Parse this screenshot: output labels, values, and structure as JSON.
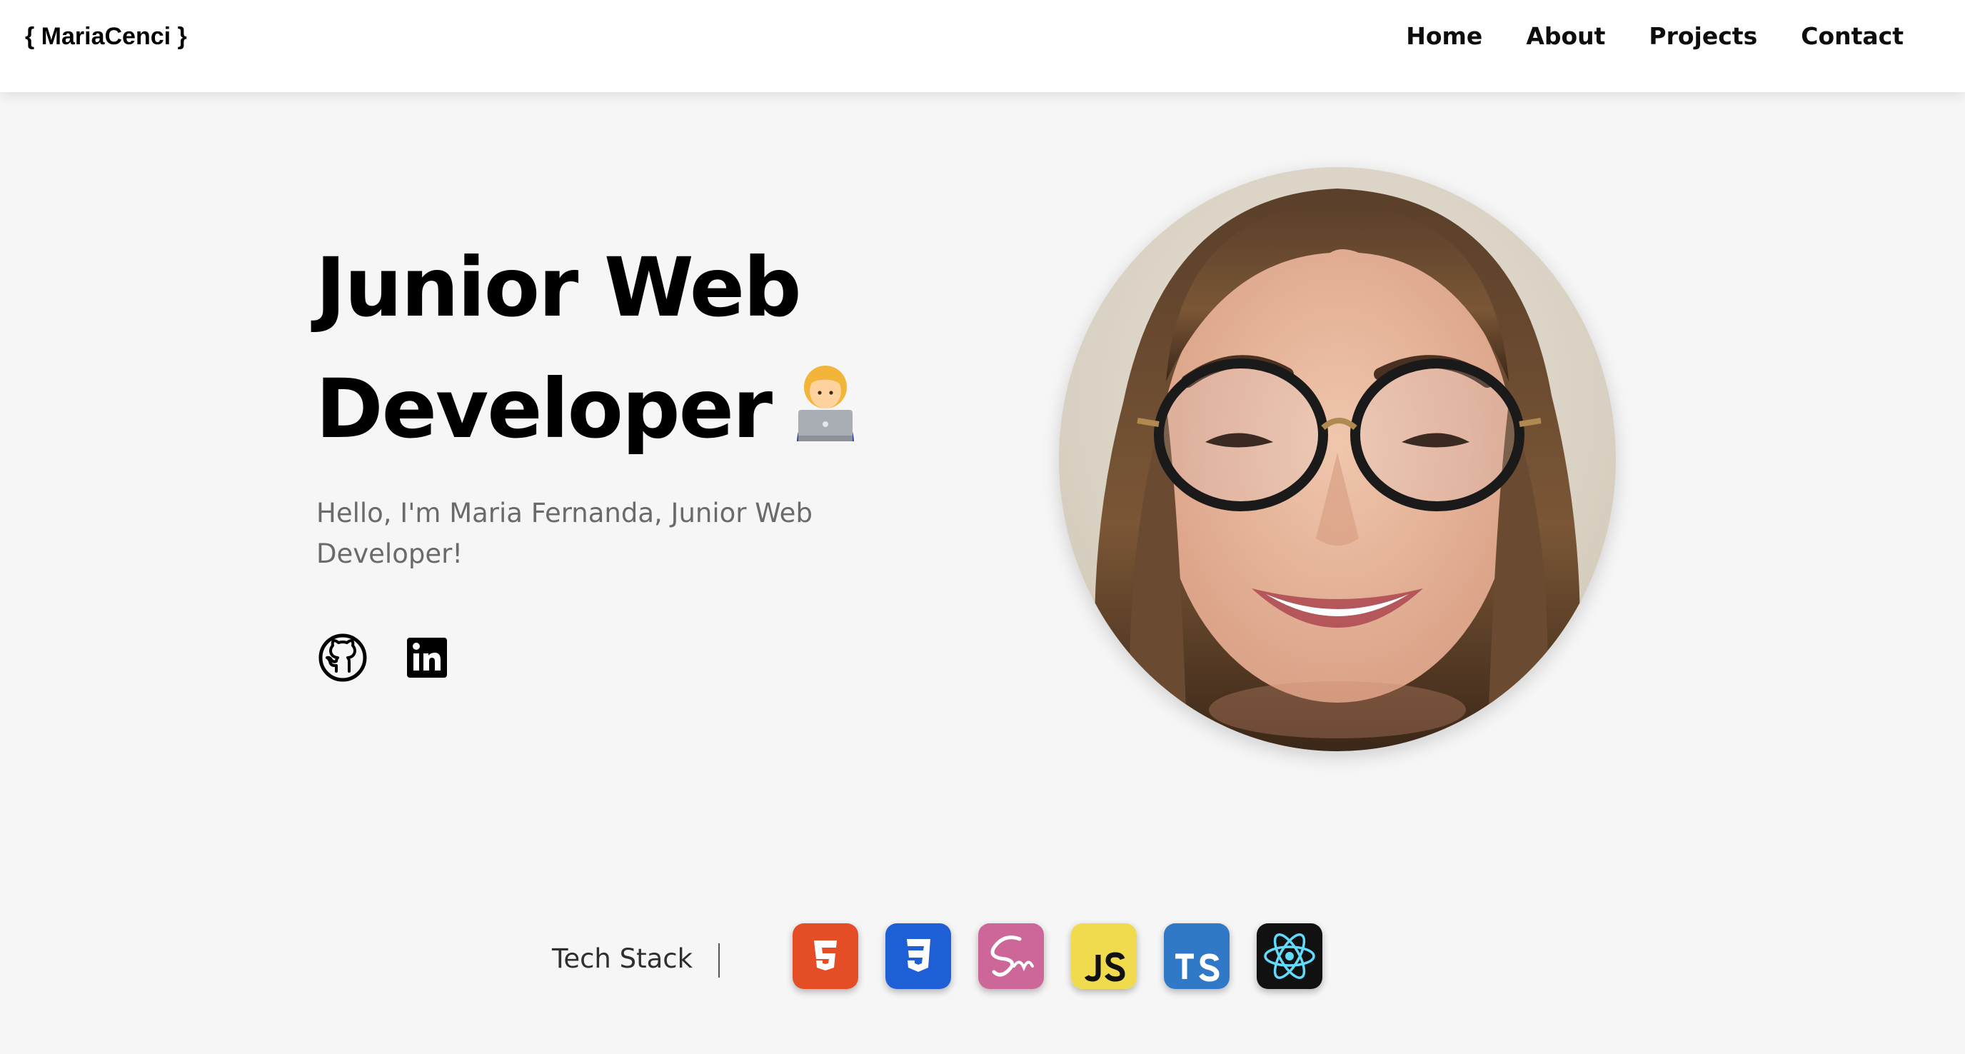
{
  "navbar": {
    "brand": "{ MariaCenci }",
    "links": [
      {
        "label": "Home"
      },
      {
        "label": "About"
      },
      {
        "label": "Projects"
      },
      {
        "label": "Contact"
      }
    ]
  },
  "hero": {
    "title_line1": "Junior Web",
    "title_line2": "Developer",
    "title_emoji": "woman-technologist-emoji-icon",
    "subtitle": "Hello, I'm Maria Fernanda, Junior Web Developer!",
    "socials": [
      {
        "icon": "github-icon"
      },
      {
        "icon": "linkedin-icon"
      }
    ],
    "portrait": "portrait-photo"
  },
  "tech_stack": {
    "label": "Tech Stack",
    "icons": [
      {
        "icon": "html5-icon",
        "color": "#e44d26"
      },
      {
        "icon": "css3-icon",
        "color": "#1f5fd6"
      },
      {
        "icon": "sass-icon",
        "color": "#cd6799"
      },
      {
        "icon": "javascript-icon",
        "color": "#f0db4f"
      },
      {
        "icon": "typescript-icon",
        "color": "#3178c6"
      },
      {
        "icon": "react-icon",
        "color": "#61dafb"
      }
    ]
  },
  "colors": {
    "background": "#f6f6f6",
    "navbar": "#ffffff",
    "subtitle": "#6a6a6a"
  }
}
